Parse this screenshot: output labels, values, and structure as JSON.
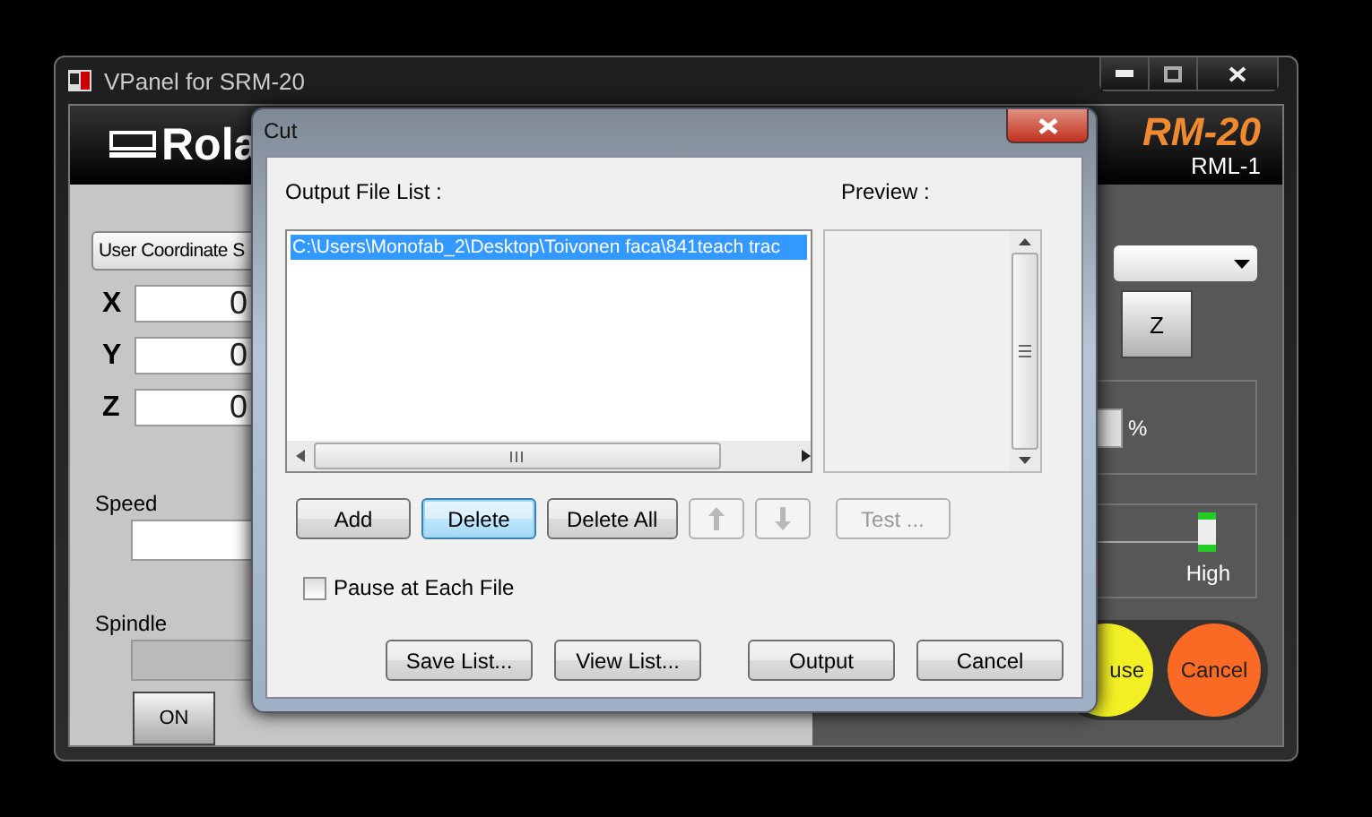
{
  "main_window": {
    "title": "VPanel for SRM-20",
    "brand": "Rola",
    "model": "RM-20",
    "model_sub": "RML-1",
    "coordinate_system": "User Coordinate S",
    "axes": [
      {
        "label": "X",
        "value": "0"
      },
      {
        "label": "Y",
        "value": "0"
      },
      {
        "label": "Z",
        "value": "0"
      }
    ],
    "speed_label": "Speed",
    "spindle_label": "Spindle",
    "spindle_on_button": "ON",
    "jog_button": "Z",
    "percent_unit": "%",
    "spindle_speed": {
      "level": 1,
      "label": "High"
    },
    "action_buttons": [
      {
        "label": "use",
        "color": "#f2f024"
      },
      {
        "label": "Cancel",
        "color": "#fa6a24"
      }
    ]
  },
  "dialog": {
    "title": "Cut",
    "list_label": "Output File List :",
    "preview_label": "Preview :",
    "files": [
      {
        "path": "C:\\Users\\Monofab_2\\Desktop\\Toivonen faca\\841teach trac",
        "selected": true
      }
    ],
    "buttons": [
      {
        "kind": "text",
        "label": "Add",
        "disabled": false,
        "focused": false
      },
      {
        "kind": "text",
        "label": "Delete",
        "disabled": false,
        "focused": true
      },
      {
        "kind": "text",
        "label": "Delete All",
        "disabled": false,
        "focused": false
      },
      {
        "kind": "up",
        "disabled": true,
        "focused": false
      },
      {
        "kind": "down",
        "disabled": true,
        "focused": false
      },
      {
        "kind": "text",
        "label": "Test ...",
        "disabled": true,
        "focused": false
      }
    ],
    "pause_at_each_file": {
      "label": "Pause at Each File",
      "checked": false
    },
    "footer_buttons": [
      {
        "label": "Save List..."
      },
      {
        "label": "View List..."
      },
      {
        "label": "Output"
      },
      {
        "label": "Cancel"
      }
    ]
  }
}
